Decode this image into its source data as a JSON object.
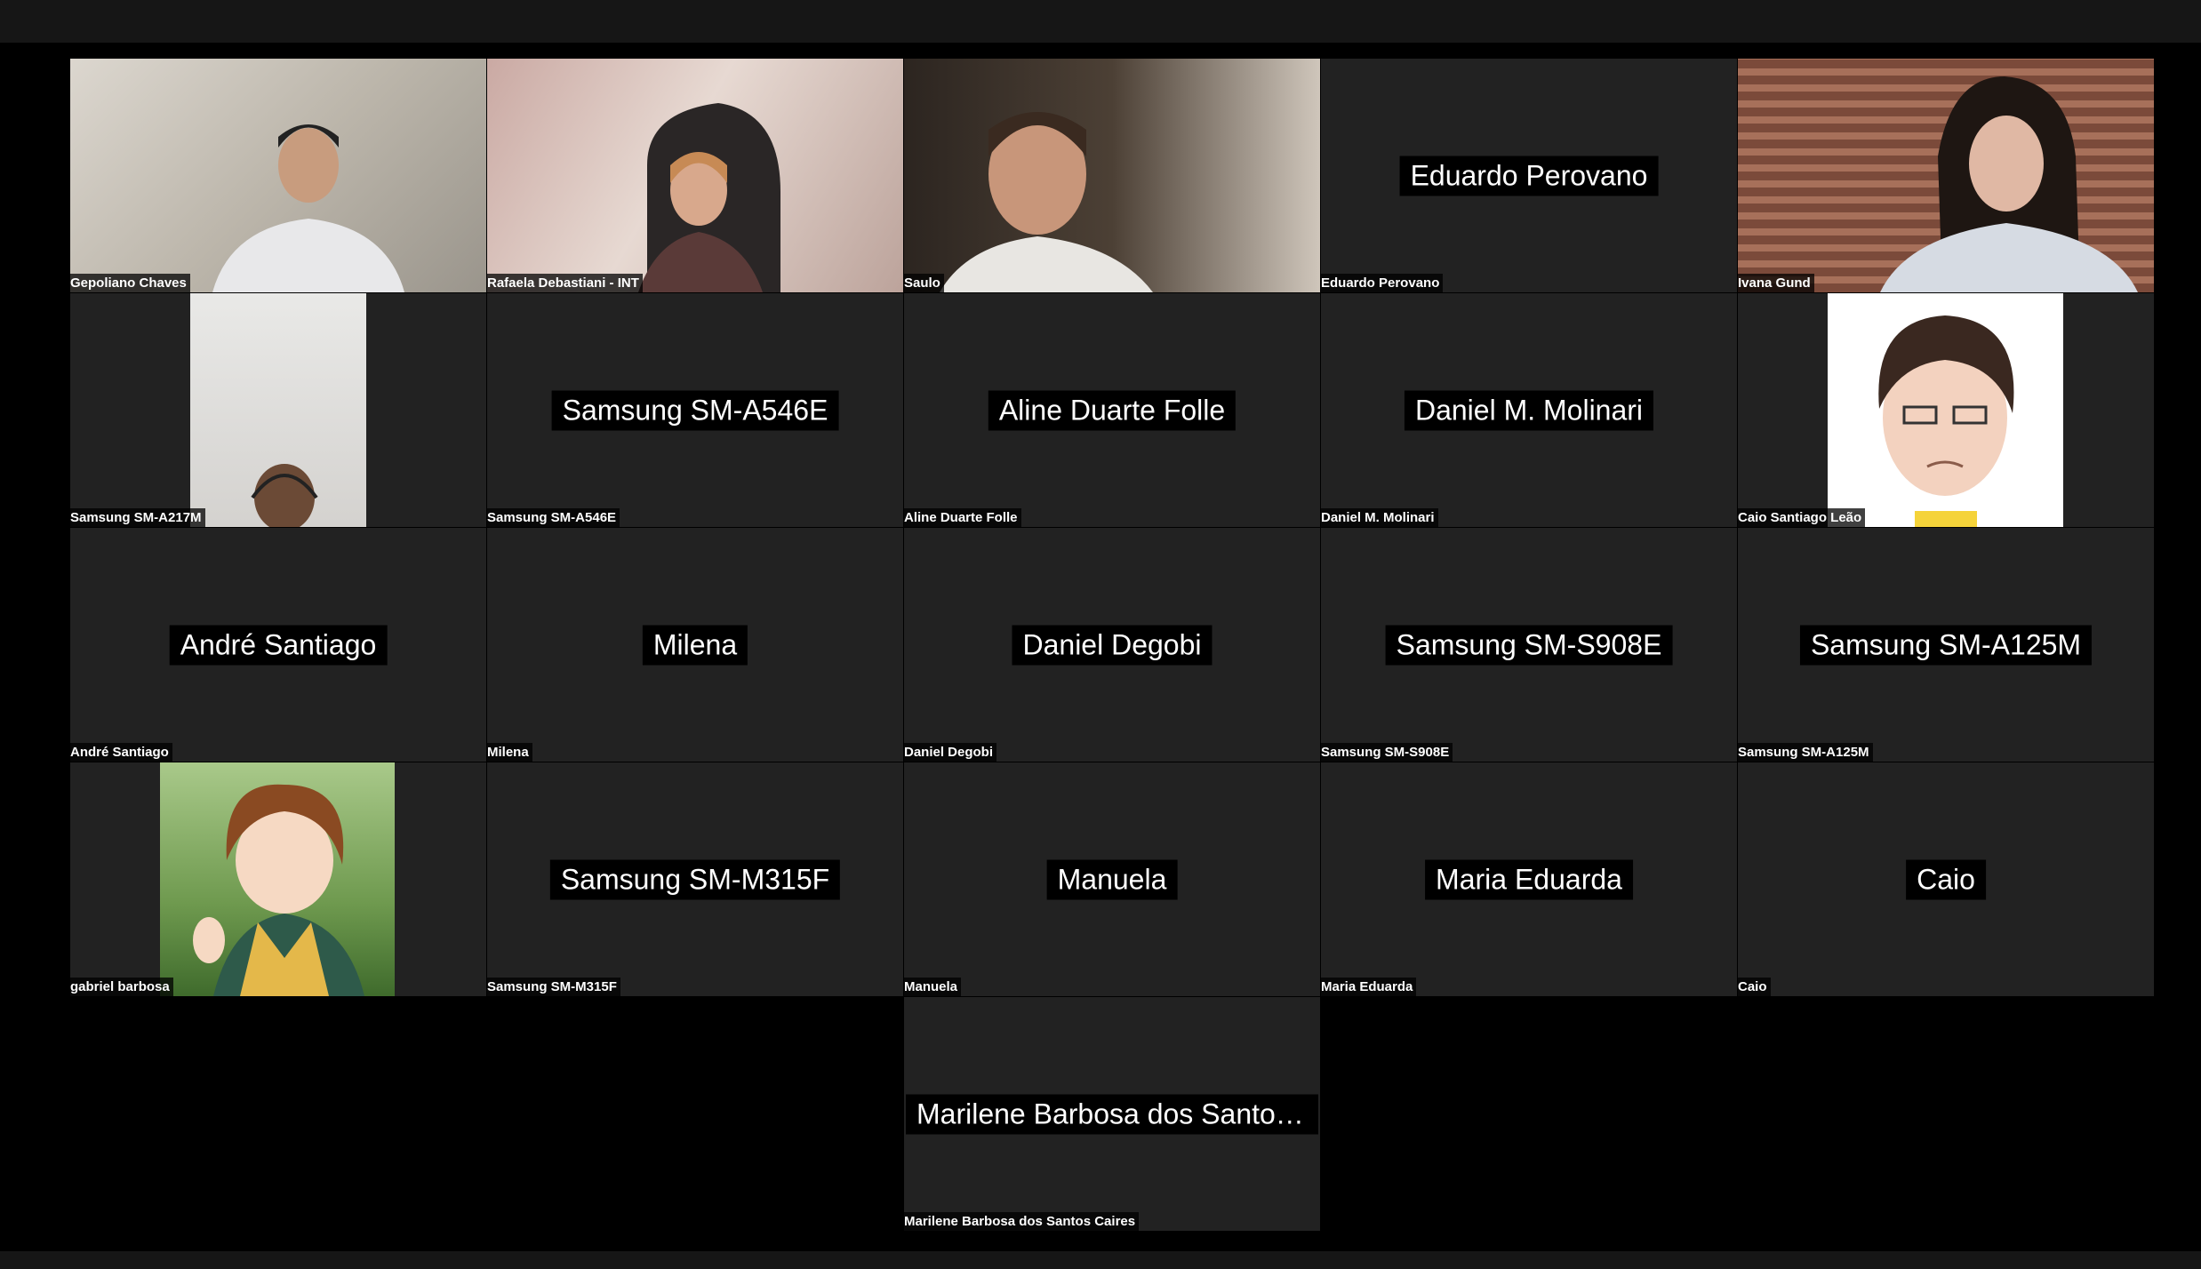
{
  "participants": {
    "p1": {
      "label": "Gepoliano Chaves",
      "big": ""
    },
    "p2": {
      "label": "Rafaela Debastiani - INT",
      "big": ""
    },
    "p3": {
      "label": "Saulo",
      "big": ""
    },
    "p4": {
      "label": "Eduardo Perovano",
      "big": "Eduardo Perovano"
    },
    "p5": {
      "label": "Ivana Gund",
      "big": ""
    },
    "p6": {
      "label": "Samsung SM-A217M",
      "big": ""
    },
    "p7": {
      "label": "Samsung SM-A546E",
      "big": "Samsung SM-A546E"
    },
    "p8": {
      "label": "Aline Duarte Folle",
      "big": "Aline Duarte Folle"
    },
    "p9": {
      "label": "Daniel M. Molinari",
      "big": "Daniel M. Molinari"
    },
    "p10": {
      "label": "Caio Santiago Leão",
      "big": ""
    },
    "p11": {
      "label": "André Santiago",
      "big": "André Santiago"
    },
    "p12": {
      "label": "Milena",
      "big": "Milena"
    },
    "p13": {
      "label": "Daniel Degobi",
      "big": "Daniel Degobi"
    },
    "p14": {
      "label": "Samsung SM-S908E",
      "big": "Samsung SM-S908E"
    },
    "p15": {
      "label": "Samsung SM-A125M",
      "big": "Samsung SM-A125M"
    },
    "p16": {
      "label": "gabriel barbosa",
      "big": ""
    },
    "p17": {
      "label": "Samsung SM-M315F",
      "big": "Samsung SM-M315F"
    },
    "p18": {
      "label": "Manuela",
      "big": "Manuela"
    },
    "p19": {
      "label": "Maria Eduarda",
      "big": "Maria Eduarda"
    },
    "p20": {
      "label": "Caio",
      "big": "Caio"
    },
    "p21": {
      "label": "Marilene Barbosa dos Santos Caires",
      "big": "Marilene Barbosa dos Santos..."
    }
  },
  "colors": {
    "tile_bg": "#222222",
    "page_bg": "#000000",
    "bar_bg": "#161616"
  }
}
